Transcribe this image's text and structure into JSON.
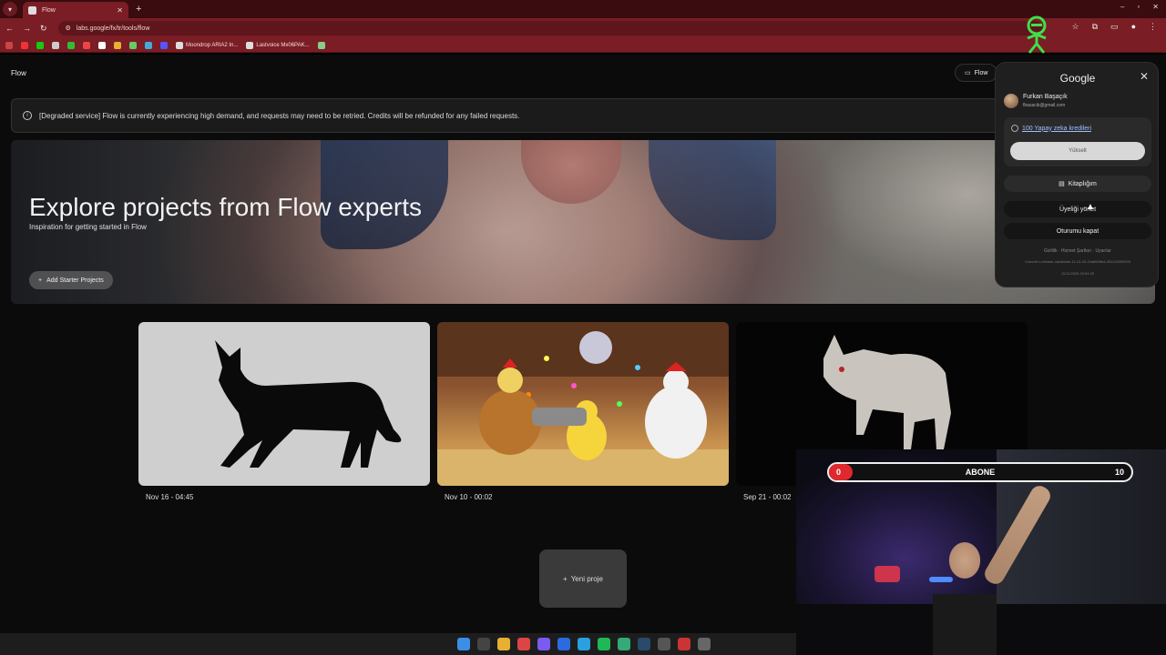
{
  "browser": {
    "tab_title": "Flow",
    "tab_close": "✕",
    "new_tab": "+",
    "url": "labs.google/fx/tr/tools/flow",
    "window_controls": [
      "–",
      "▫",
      "✕"
    ],
    "bookmarks": [
      "Moondrop ARIA2 In...",
      "Lastvoice Mx06PAK..."
    ]
  },
  "app": {
    "title": "Flow",
    "top_button": "Flow"
  },
  "banner": {
    "text": "[Degraded service] Flow is currently experiencing high demand, and requests may need to be retried. Credits will be refunded for any failed requests."
  },
  "hero": {
    "title": "Explore projects from Flow experts",
    "subtitle": "Inspiration for getting started in Flow",
    "button": "Add Starter Projects"
  },
  "projects": [
    {
      "date": "Nov 16 - 04:45"
    },
    {
      "date": "Nov 10 - 00:02"
    },
    {
      "date": "Sep 21 - 00:02"
    }
  ],
  "new_project": {
    "label": "Yeni proje"
  },
  "account_popup": {
    "brand": "Google",
    "close": "✕",
    "name": "Furkan Başaçık",
    "email": "fbasacik@gmail.com",
    "credits": "100 Yapay zeka kredileri",
    "upgrade": "Yükselt",
    "library": "Kitaplığım",
    "manage_membership": "Üyeliği yönet",
    "sign_out": "Oturumu kapat",
    "links": "Gizlilik   ·   Hizmet Şartları   ·   Uyarılar",
    "build": "Commit v-release-candidate-11-13-25-10a8606ba-251119092903",
    "timestamp": "11/11/2025 20:54:33"
  },
  "stream_overlay": {
    "goal_label": "ABONE",
    "current": "0",
    "target": "10",
    "progress": 0
  },
  "colors": {
    "browser_frame": "#7a1d24",
    "page_bg": "#0b0b0b",
    "popup_bg": "#1f1f1f",
    "sub_bar_red": "#e0282f"
  }
}
